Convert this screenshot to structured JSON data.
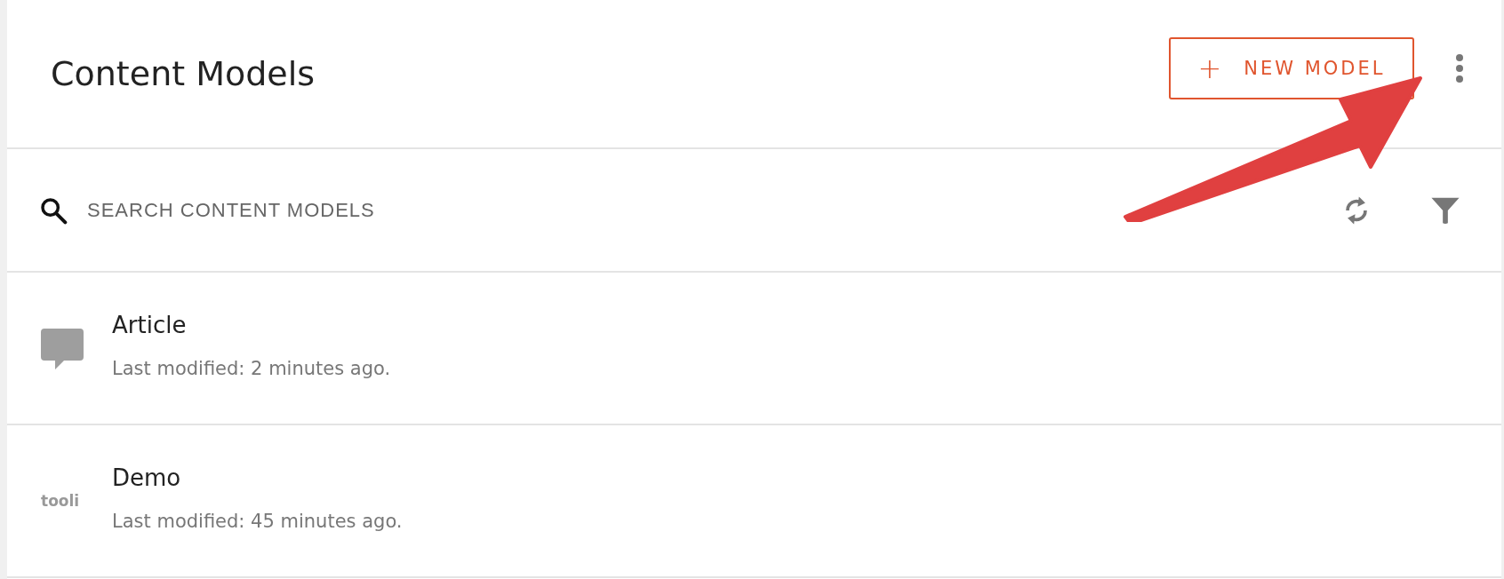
{
  "header": {
    "title": "Content Models",
    "new_button": {
      "icon": "+",
      "label": "NEW MODEL"
    }
  },
  "search": {
    "placeholder": "SEARCH CONTENT MODELS"
  },
  "models": [
    {
      "kind": "comment",
      "title": "Article",
      "subtitle": "Last modified: 2 minutes ago."
    },
    {
      "kind": "logo",
      "logo_text": "tooli",
      "title": "Demo",
      "subtitle": "Last modified: 45 minutes ago."
    }
  ]
}
